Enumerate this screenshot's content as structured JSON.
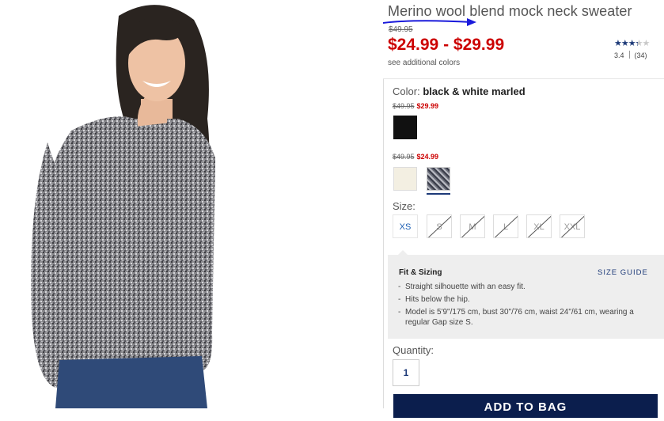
{
  "product": {
    "title": "Merino wool blend mock neck sweater",
    "original_price": "$49.95",
    "price_range": "$24.99 - $29.99",
    "see_colors_link": "see additional colors",
    "rating": {
      "stars": 3.4,
      "average_label": "3.4",
      "count_label": "(34)"
    },
    "photo_icon": "model-wearing-sweater-image"
  },
  "color": {
    "label": "Color:",
    "selected": "black & white marled",
    "groups": [
      {
        "original": "$49.95",
        "sale": "$29.99",
        "swatches": [
          "black"
        ]
      },
      {
        "original": "$49.95",
        "sale": "$24.99",
        "swatches": [
          "cream",
          "black & white marled"
        ]
      }
    ]
  },
  "size": {
    "label": "Size:",
    "options": [
      {
        "label": "XS",
        "available": true
      },
      {
        "label": "S",
        "available": false
      },
      {
        "label": "M",
        "available": false
      },
      {
        "label": "L",
        "available": false
      },
      {
        "label": "XL",
        "available": false
      },
      {
        "label": "XXL",
        "available": false
      }
    ]
  },
  "fit": {
    "title": "Fit & Sizing",
    "size_guide": "SIZE GUIDE",
    "items": [
      "Straight silhouette with an easy fit.",
      "Hits below the hip.",
      "Model is 5'9\"/175 cm, bust 30\"/76 cm, waist 24\"/61 cm, wearing a regular Gap size S."
    ]
  },
  "quantity": {
    "label": "Quantity:",
    "value": "1"
  },
  "add_to_bag": "ADD TO BAG",
  "colors": {
    "sale_red": "#cc0000",
    "navy": "#0b1e4d",
    "link_blue": "#1d3a78"
  }
}
